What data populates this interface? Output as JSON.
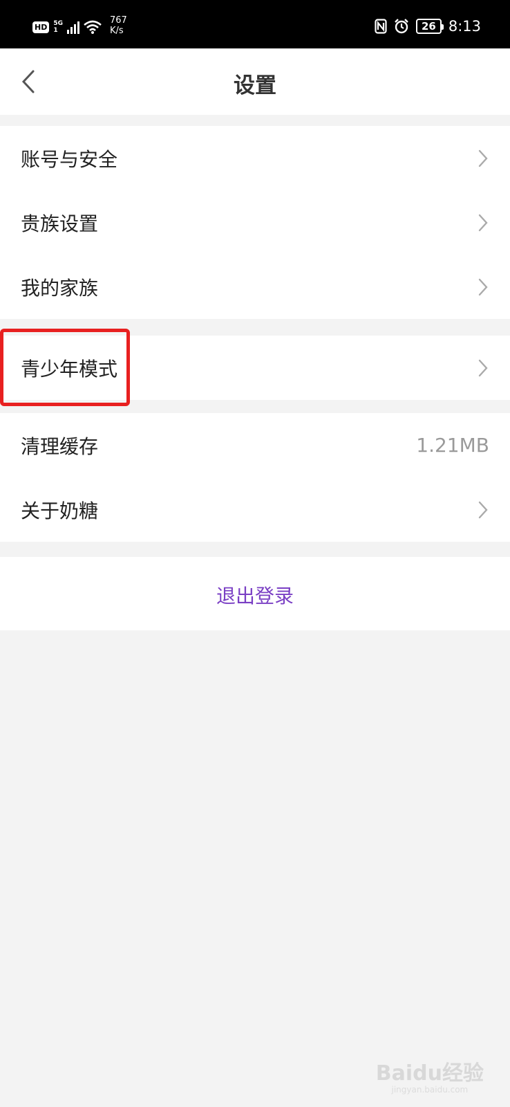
{
  "status_bar": {
    "hd_badge": "HD",
    "network": "5G",
    "sim_sub": "1",
    "speed_value": "767",
    "speed_unit": "K/s",
    "battery": "26",
    "time": "8:13",
    "icons": [
      "signal-icon",
      "wifi-icon",
      "nfc-icon",
      "alarm-icon",
      "battery-icon"
    ]
  },
  "header": {
    "title": "设置",
    "back_icon": "chevron-left-icon"
  },
  "groups": [
    {
      "items": [
        {
          "label": "账号与安全",
          "action": "chevron-right-icon"
        },
        {
          "label": "贵族设置",
          "action": "chevron-right-icon"
        },
        {
          "label": "我的家族",
          "action": "chevron-right-icon"
        }
      ]
    },
    {
      "items": [
        {
          "label": "青少年模式",
          "action": "chevron-right-icon"
        }
      ]
    },
    {
      "items": [
        {
          "label": "清理缓存",
          "value": "1.21MB"
        },
        {
          "label": "关于奶糖",
          "action": "chevron-right-icon"
        }
      ]
    }
  ],
  "logout": {
    "label": "退出登录"
  },
  "colors": {
    "accent": "#7a3fc4",
    "highlight": "#e82020",
    "background": "#f3f3f3"
  },
  "watermark": {
    "text": "Baidu经验",
    "sub": "jingyan.baidu.com"
  }
}
